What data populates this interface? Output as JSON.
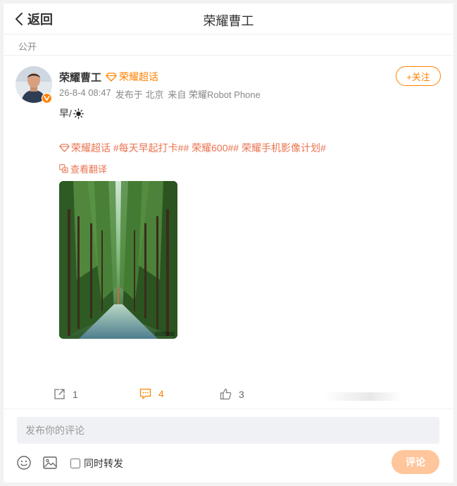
{
  "header": {
    "back_label": "返回",
    "title": "荣耀曹工"
  },
  "post": {
    "visibility": "公开",
    "author": {
      "name": "荣耀曹工",
      "verified": true,
      "topic_tag": "荣耀超话"
    },
    "follow_label": "+关注",
    "meta": {
      "time": "26-8-4 08:47",
      "location": "发布于 北京",
      "source": "来自 荣耀Robot Phone"
    },
    "text": "早/",
    "text_icon": "sun-icon",
    "hashtags": "荣耀超话 #每天早起打卡## 荣耀600## 荣耀手机影像计划#",
    "translate_label": "查看翻译",
    "image": {
      "subject": "forest road with tall pine trees",
      "watermark": "@荣耀曹工"
    }
  },
  "actions": {
    "repost_count": "1",
    "comment_count": "4",
    "like_count": "3"
  },
  "composer": {
    "placeholder": "发布你的评论",
    "repost_label": "同时转发",
    "repost_checked": false,
    "submit_label": "评论"
  },
  "colors": {
    "accent": "#ff8200",
    "link": "#eb7350",
    "submit_disabled": "#ffc59b"
  }
}
